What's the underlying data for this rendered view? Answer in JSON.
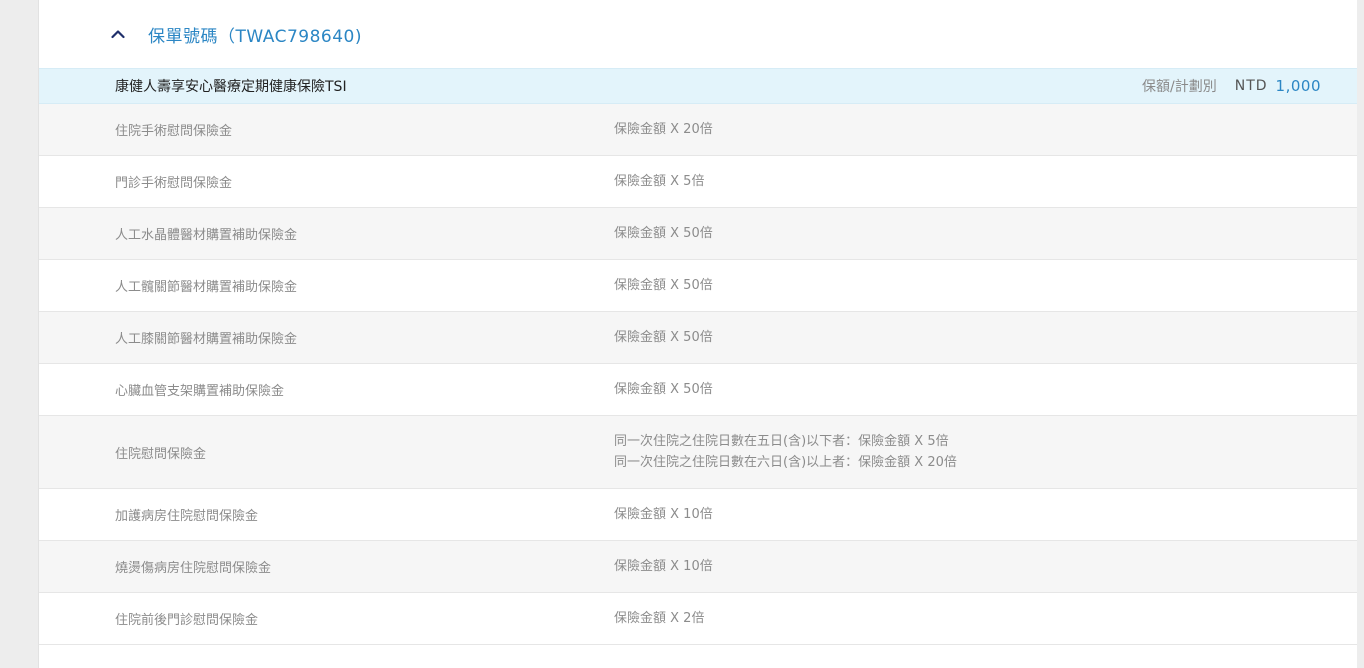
{
  "policy": {
    "title": "保單號碼（TWAC798640)",
    "chevron_icon": "chevron-up-icon",
    "accent_color": "#2b86c4"
  },
  "plan": {
    "name": "康健人壽享安心醫療定期健康保險TSI",
    "unit_label": "保額/計劃別",
    "currency": "NTD",
    "amount": "1,000"
  },
  "benefits": [
    {
      "name": "住院手術慰問保險金",
      "value_lines": [
        "保險金額 X 20倍"
      ]
    },
    {
      "name": "門診手術慰問保險金",
      "value_lines": [
        "保險金額 X 5倍"
      ]
    },
    {
      "name": "人工水晶體醫材購置補助保險金",
      "value_lines": [
        "保險金額 X 50倍"
      ]
    },
    {
      "name": "人工髖關節醫材購置補助保險金",
      "value_lines": [
        "保險金額 X 50倍"
      ]
    },
    {
      "name": "人工膝關節醫材購置補助保險金",
      "value_lines": [
        "保險金額 X 50倍"
      ]
    },
    {
      "name": "心臟血管支架購置補助保險金",
      "value_lines": [
        "保險金額 X 50倍"
      ]
    },
    {
      "name": "住院慰問保險金",
      "value_lines": [
        "同一次住院之住院日數在五日(含)以下者：保險金額 X 5倍",
        "同一次住院之住院日數在六日(含)以上者：保險金額 X 20倍"
      ]
    },
    {
      "name": "加護病房住院慰問保險金",
      "value_lines": [
        "保險金額 X 10倍"
      ]
    },
    {
      "name": "燒燙傷病房住院慰問保險金",
      "value_lines": [
        "保險金額 X 10倍"
      ]
    },
    {
      "name": "住院前後門診慰問保險金",
      "value_lines": [
        "保險金額 X 2倍"
      ]
    }
  ]
}
